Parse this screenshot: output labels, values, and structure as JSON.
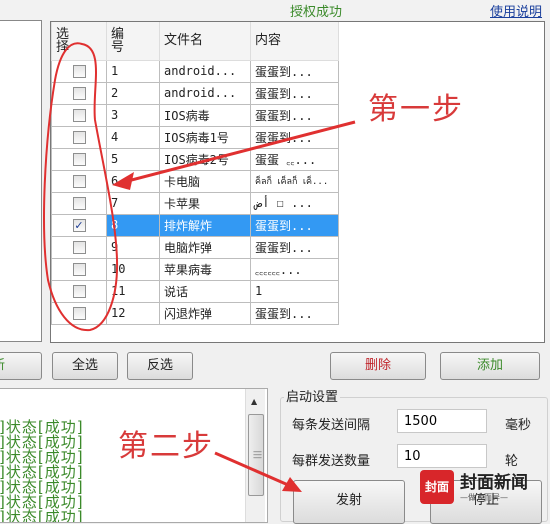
{
  "header": {
    "auth_status": "授权成功",
    "help_link": "使用说明"
  },
  "table": {
    "columns": [
      "选\n择",
      "编\n号",
      "文件名",
      "内容"
    ],
    "col_select_1": "选",
    "col_select_2": "择",
    "col_id_1": "编",
    "col_id_2": "号",
    "col_name": "文件名",
    "col_content": "内容",
    "rows": [
      {
        "checked": false,
        "id": "1",
        "name": "android...",
        "content": "蛋蛋到..."
      },
      {
        "checked": false,
        "id": "2",
        "name": "android...",
        "content": "蛋蛋到..."
      },
      {
        "checked": false,
        "id": "3",
        "name": "IOS病毒",
        "content": "蛋蛋到..."
      },
      {
        "checked": false,
        "id": "4",
        "name": "IOS病毒1号",
        "content": "蛋蛋到..."
      },
      {
        "checked": false,
        "id": "5",
        "name": "IOS病毒2号",
        "content": "蛋蛋 ꜀꜀..."
      },
      {
        "checked": false,
        "id": "6",
        "name": "卡电脑",
        "content": "ค็ลก็ เค็ลก็ เค็..."
      },
      {
        "checked": false,
        "id": "7",
        "name": "卡苹果",
        "content": "أض ☐ ..."
      },
      {
        "checked": true,
        "id": "8",
        "name": "排炸解炸",
        "content": "蛋蛋到..."
      },
      {
        "checked": false,
        "id": "9",
        "name": "电脑炸弹",
        "content": "蛋蛋到..."
      },
      {
        "checked": false,
        "id": "10",
        "name": "苹果病毒",
        "content": " ꜀꜀꜀꜀꜀꜀..."
      },
      {
        "checked": false,
        "id": "11",
        "name": "说话",
        "content": "1"
      },
      {
        "checked": false,
        "id": "12",
        "name": "闪退炸弹",
        "content": "蛋蛋到..."
      }
    ]
  },
  "buttons": {
    "refresh": "新",
    "select_all": "全选",
    "invert": "反选",
    "delete": "删除",
    "add": "添加",
    "fire": "发射",
    "stop": "停止"
  },
  "log": {
    "lines": [
      "]状态[成功]",
      "]状态[成功]",
      "]状态[成功]",
      "]状态[成功]",
      "]状态[成功]",
      "]状态[成功]",
      "]状态[成功]"
    ]
  },
  "settings": {
    "title": "启动设置",
    "interval_label": "每条发送间隔",
    "interval_value": "1500",
    "interval_unit": "毫秒",
    "count_label": "每群发送数量",
    "count_value": "10",
    "count_unit": "轮"
  },
  "annotations": {
    "step1": "第一步",
    "step2": "第二步"
  },
  "watermark": {
    "logo": "封面",
    "name": "封面新闻",
    "slogan": "—做人而异—"
  },
  "colors": {
    "success_green": "#3b8a2a",
    "link_blue": "#1a3f9c",
    "selection_blue": "#3399f3",
    "annotation_red": "#d83a3a",
    "delete_red": "#c0242a"
  }
}
